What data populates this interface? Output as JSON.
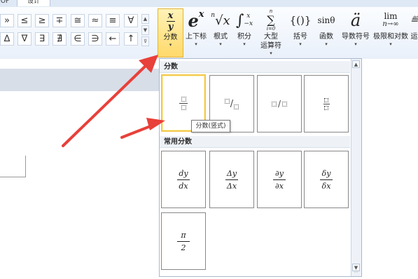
{
  "tabs": [
    {
      "label": "OF"
    },
    {
      "label": "设计"
    }
  ],
  "symbols": {
    "row1": [
      "»",
      "≤",
      "≥",
      "∓",
      "≅",
      "≈",
      "≡",
      "∀"
    ],
    "row2": [
      "∆",
      "∇",
      "∃",
      "∄",
      "∈",
      "∋",
      "←",
      "↑"
    ]
  },
  "ribbon": {
    "fraction": {
      "label": "分数",
      "glyph_top": "x",
      "glyph_bottom": "y",
      "icon": "fraction-icon"
    },
    "script": {
      "label": "上下标",
      "glyph": "e",
      "sup": "x",
      "icon": "superscript-icon"
    },
    "radical": {
      "label": "根式",
      "glyph_index": "n",
      "glyph": "√x",
      "icon": "radical-icon"
    },
    "integral": {
      "label": "积分",
      "glyph": "∫",
      "sup": "x",
      "sub": "−x",
      "icon": "integral-icon"
    },
    "large_operator": {
      "label_line1": "大型",
      "label_line2": "运算符",
      "glyph_top": "n",
      "glyph": "∑",
      "glyph_bottom": "i=0",
      "icon": "large-operator-icon"
    },
    "bracket": {
      "label": "括号",
      "glyph": "{()}",
      "icon": "bracket-icon"
    },
    "function": {
      "label": "函数",
      "glyph": "sinθ",
      "icon": "function-icon"
    },
    "accent": {
      "label": "导数符号",
      "glyph": "ä",
      "icon": "accent-icon"
    },
    "limit": {
      "label": "极限和对数",
      "glyph": "lim",
      "glyph_bottom": "n→∞",
      "icon": "limit-icon"
    },
    "operator": {
      "label": "运",
      "icon": "operator-icon"
    }
  },
  "gallery": {
    "section1_title": "分数",
    "section2_title": "常用分数",
    "tooltip": "分数(竖式)",
    "common_fractions": [
      {
        "num": "dy",
        "den": "dx"
      },
      {
        "num": "Δy",
        "den": "Δx"
      },
      {
        "num": "∂y",
        "den": "∂x"
      },
      {
        "num": "δy",
        "den": "δx"
      },
      {
        "num": "π",
        "den": "2"
      }
    ]
  },
  "colors": {
    "active_button": "#ffd96a",
    "active_border": "#e2b33c",
    "arrow": "#e8403a"
  }
}
